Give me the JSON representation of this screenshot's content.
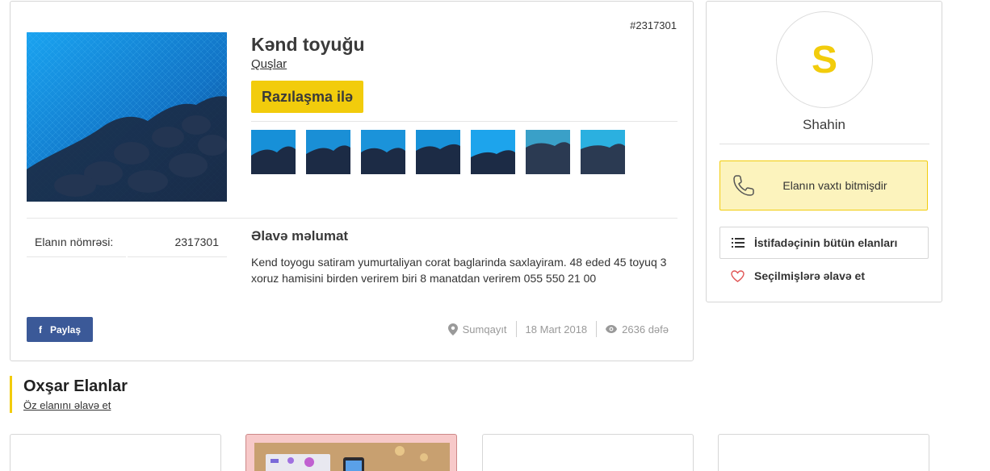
{
  "listing": {
    "id_label": "#2317301",
    "title": "Kənd toyuğu",
    "category": "Quşlar",
    "price": "Razılaşma ilə",
    "thumb_count": 7,
    "info": {
      "number_label": "Elanın nömrəsi:",
      "number_value": "2317301"
    },
    "extra_title": "Əlavə məlumat",
    "extra_text": "Kend toyogu satiram yumurtaliyan corat baglarinda saxlayiram. 48 eded 45 toyuq 3 xoruz hamisini birden verirem biri 8 manatdan verirem 055 550 21 00",
    "share_label": "Paylaş",
    "share_icon": "facebook-icon",
    "city": "Sumqayıt",
    "date": "18 Mart 2018",
    "views": "2636 dəfə"
  },
  "user": {
    "initial": "S",
    "name": "Shahin",
    "expired_label": "Elanın vaxtı bitmişdir",
    "all_ads_label": "İstifadəçinin bütün elanları",
    "favorite_label": "Seçilmişlərə əlavə et"
  },
  "similar": {
    "heading": "Oxşar Elanlar",
    "add_link": "Öz elanını əlavə et"
  },
  "colors": {
    "accent": "#f2cc0c",
    "facebook": "#3b5998",
    "highlight_card": "#f7c9c9"
  }
}
